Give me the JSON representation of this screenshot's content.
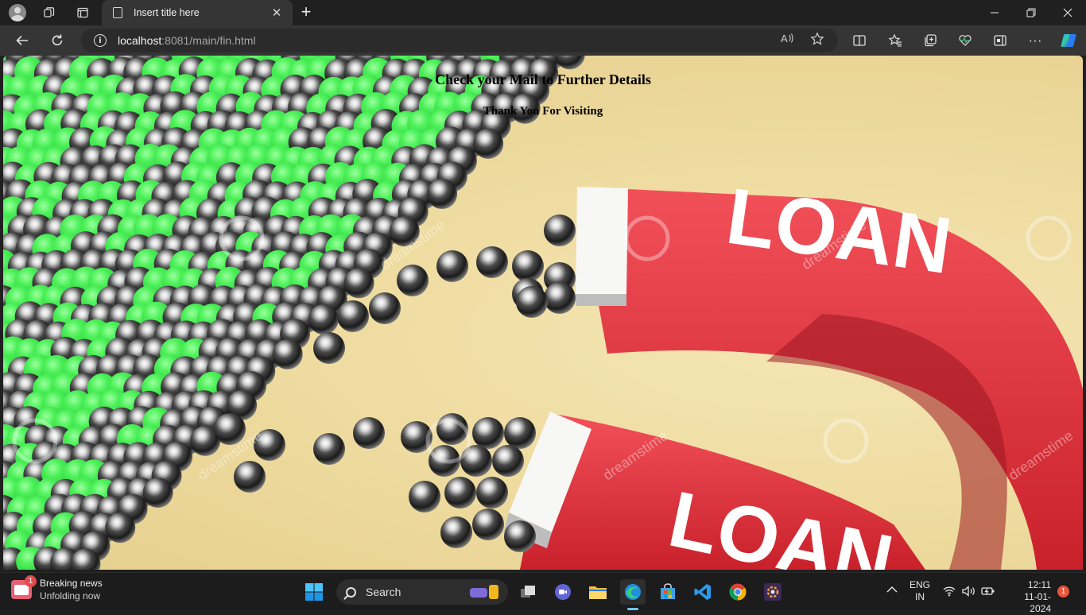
{
  "browser": {
    "tab_title": "Insert title here",
    "tab_close": "✕",
    "new_tab": "+",
    "window": {
      "minimize": "—",
      "restore": "❐",
      "close": "✕"
    },
    "url_host": "localhost",
    "url_rest": ":8081/main/fin.html",
    "info": "i",
    "icons": {
      "back": "back-arrow-icon",
      "refresh": "refresh-icon",
      "read_aloud": "read-aloud-icon",
      "favorite": "star-icon",
      "split": "split-screen-icon",
      "favorites": "favorites-icon",
      "collections": "collections-icon",
      "performance": "heartbeat-icon",
      "sidebar": "sidebar-icon",
      "more": "more-icon",
      "copilot": "copilot-icon"
    },
    "more_label": "···",
    "read_aloud_label": "Ȃ",
    "star_label": "☆"
  },
  "page": {
    "heading": "Check your Mail to Further Details",
    "subheading": "Thank You For Visiting",
    "image_text": "LOAN",
    "watermark": "dreamstime"
  },
  "taskbar": {
    "news_title": "Breaking news",
    "news_subtitle": "Unfolding now",
    "news_badge": "1",
    "search_label": "Search",
    "lang_top": "ENG",
    "lang_bottom": "IN",
    "time": "12:11",
    "date": "11-01-2024",
    "notification_count": "1"
  },
  "colors": {
    "browser_bg": "#202020",
    "toolbar_bg": "#353535",
    "magnet_red": "#e2373f",
    "ball_green": "#3ee64a",
    "background_cream": "#eedb9f",
    "accent": "#6ec7ff"
  }
}
